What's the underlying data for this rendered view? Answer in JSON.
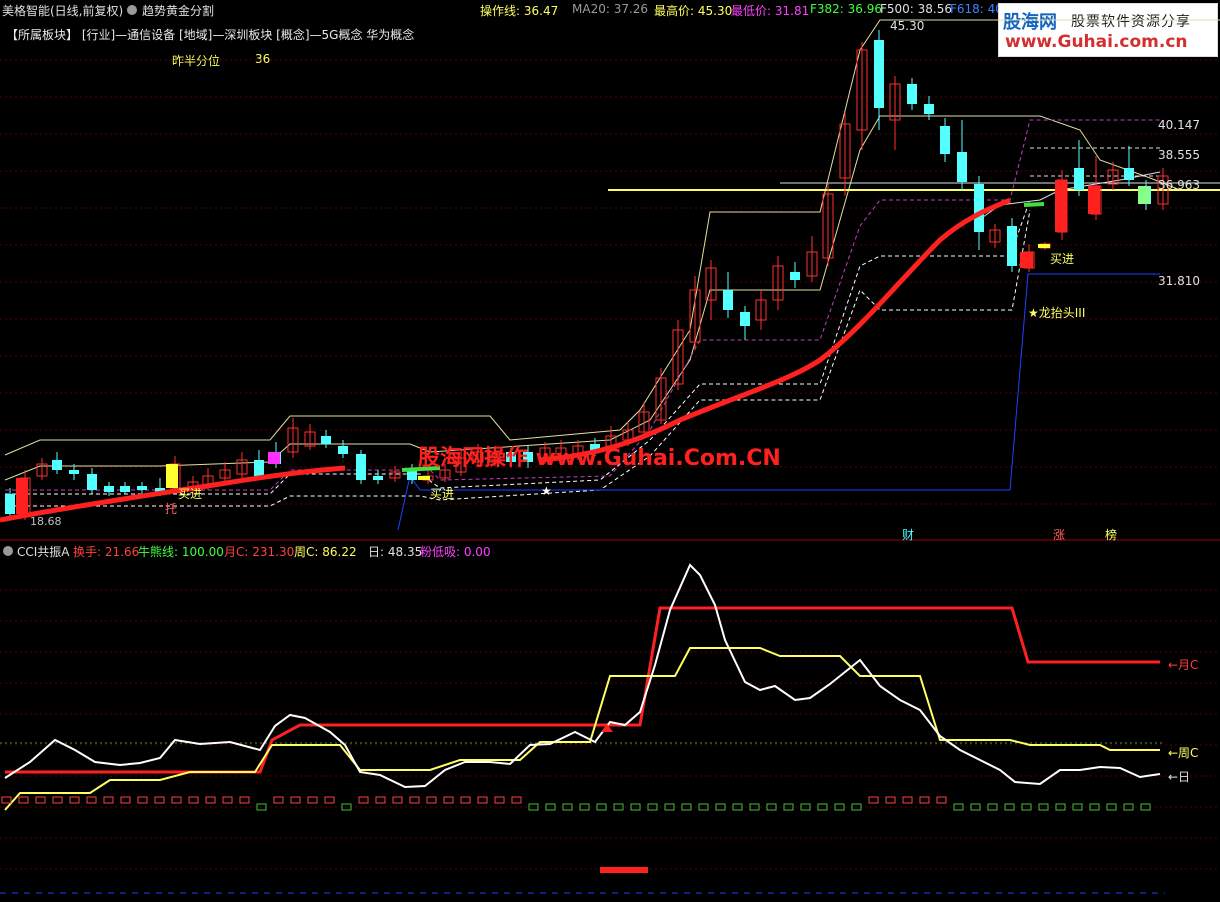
{
  "header": {
    "stock_name": "美格智能(日线,前复权)",
    "indicator_name": "趋势黄金分割",
    "op_line_label": "操作线: 36.47",
    "ma20_label": "MA20: 37.26",
    "high_label": "最高价: 45.30",
    "low_label": "最低价: 31.81",
    "f382_label": "F382: 36.96",
    "f500_label": "F500: 38.56",
    "f618_label": "F618: 40"
  },
  "sector_line": "【所属板块】 [行业]—通信设备 [地域]—深圳板块 [概念]—5G概念 华为概念",
  "half_percentile": {
    "label": "昨半分位",
    "value": "36"
  },
  "logo": {
    "brand": "股海网",
    "slogan": "股票软件资源分享",
    "url": "www.Guhai.com.cn"
  },
  "watermark": "股海网操作 www.Guhai.Com.CN",
  "markers": {
    "buy1": "买进",
    "buy2": "买进",
    "buy3": "买进",
    "tuo": "托",
    "dragon": "★龙抬头III",
    "cai": "财",
    "zhang": "涨",
    "bang": "榜",
    "low_price": "18.68"
  },
  "price_labels": {
    "p1": "45.30",
    "p2": "40.147",
    "p3": "38.555",
    "p4": "36.963",
    "p5": "31.810",
    "p6": "45.300"
  },
  "indicator": {
    "name": "CCI共振A",
    "huanshou": "换手: 21.66",
    "niuxiong": "牛熊线: 100.00",
    "yue": "月C: 231.30",
    "zhou": "周C: 86.22",
    "ri": "日: 48.35",
    "fendixi": "粉低吸: 0.00",
    "label_yue": "←月C",
    "label_zhou": "←周C",
    "label_ri": "←日"
  },
  "colors": {
    "up": "#ff3030",
    "down": "#54ffff",
    "ma": "#ff2020",
    "yellow": "#ffff60",
    "panel_bg": "#000000"
  },
  "chart_data": {
    "type": "candlestick",
    "price_high": 45.3,
    "price_low": 18.68,
    "levels": {
      "f618": 40.147,
      "f500": 38.555,
      "f382": 36.963,
      "low": 31.81
    }
  }
}
